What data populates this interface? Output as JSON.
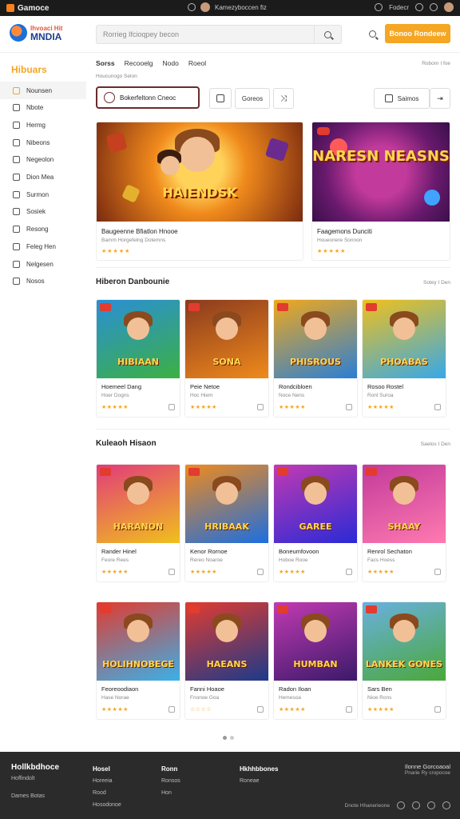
{
  "topbar": {
    "brand": "Gamoce",
    "center_text": "Kamezyboccen fiz",
    "right_text": "Fodecr"
  },
  "header": {
    "logo_line1": "Ihvoaci Hit",
    "logo_line2": "MNDIA",
    "search_placeholder": "Rorrieg Ifcioqpey becon",
    "cta_label": "Bonoo Rondeew"
  },
  "sidebar": {
    "title": "Hibuars",
    "items": [
      {
        "label": "Nounsen",
        "icon": "square-icon"
      },
      {
        "label": "Nbote",
        "icon": "grid-icon"
      },
      {
        "label": "Hermg",
        "icon": "pen-icon"
      },
      {
        "label": "Nibeons",
        "icon": "list-icon"
      },
      {
        "label": "Negeolon",
        "icon": "pen-icon"
      },
      {
        "label": "Dion Mea",
        "icon": "chat-icon"
      },
      {
        "label": "Surmon",
        "icon": "list-icon"
      },
      {
        "label": "Sosiek",
        "icon": "gear-icon"
      },
      {
        "label": "Resong",
        "icon": "square-icon"
      },
      {
        "label": "Feleg Hen",
        "icon": "grid-icon"
      },
      {
        "label": "Nelgesen",
        "icon": "list-icon"
      },
      {
        "label": "Nosos",
        "icon": "pen-icon"
      }
    ]
  },
  "main": {
    "tabs": [
      "Sorss",
      "Recooelg",
      "Nodo",
      "Roeol"
    ],
    "breadcrumb": "Houcunogo Selon",
    "top_right": "Robonr I foe",
    "filter_primary": "Bokerfeltonn Cneoc",
    "filter_buttons": [
      "",
      "Goreos",
      "",
      "Saimos",
      ""
    ],
    "heroes": [
      {
        "art_title": "HAIENDSK",
        "name": "Baugeenne Bfiatlon Hnooe",
        "sub": "Bamm Horgefelng Dotemns",
        "rating": "★★★★★"
      },
      {
        "art_title": "NARESN NEASNS",
        "name": "Faagemons Dunciti",
        "sub": "Houeonere Sonnon",
        "rating": "★★★★★"
      }
    ],
    "section1": {
      "title": "Hiberon Danbounie",
      "more": "Sotey I Den"
    },
    "section2": {
      "title": "Kuleaoh Hisaon",
      "more": "Saelos I Den"
    },
    "cards_row1": [
      {
        "art": "HIBIAAN",
        "name": "Hoemeel Dang",
        "sub": "Hoer Dogns",
        "rating": "★★★★★"
      },
      {
        "art": "SONA",
        "name": "Peie Netoe",
        "sub": "Hoc Hiem",
        "rating": "★★★★★"
      },
      {
        "art": "PHISROUS",
        "name": "Rondcibloen",
        "sub": "Noce Nens",
        "rating": "★★★★★"
      },
      {
        "art": "PHOABAS",
        "name": "Rosoo Rostel",
        "sub": "Ronl Suroa",
        "rating": "★★★★★"
      }
    ],
    "cards_row2": [
      {
        "art": "HARANON",
        "name": "Rander Hinel",
        "sub": "Feore Rees",
        "rating": "★★★★★"
      },
      {
        "art": "HRIBAAK",
        "name": "Kenor Rornoe",
        "sub": "Rereo Noaroe",
        "rating": "★★★★★"
      },
      {
        "art": "GAREE",
        "name": "Boneumfovoon",
        "sub": "Hoboe Rooe",
        "rating": "★★★★★"
      },
      {
        "art": "SHAAY",
        "name": "Renrol Sechaton",
        "sub": "Facs Hoess",
        "rating": "★★★★★"
      }
    ],
    "cards_row3": [
      {
        "art": "HOLIHNOBEGE",
        "name": "Feoreoodiaon",
        "sub": "Hase Norae",
        "rating": "★★★★★"
      },
      {
        "art": "HAEANS",
        "name": "Fanni Hoaoe",
        "sub": "Fnonoe Goa",
        "rating": "☆☆☆☆"
      },
      {
        "art": "HUMBAN",
        "name": "Radon Iloan",
        "sub": "Hemesoa",
        "rating": "★★★★★"
      },
      {
        "art": "LANKEK GONES",
        "name": "Sars Ben",
        "sub": "Nioe Rons",
        "rating": "★★★★★"
      }
    ]
  },
  "footer": {
    "brand": "Hollkbdhoce",
    "brand_sub": "Hoffindolt",
    "brand_sub2": "Dames Botas",
    "col1": {
      "head": "Hosel",
      "items": [
        "Horeeia",
        "Rood",
        "Hosodonoe"
      ]
    },
    "col2": {
      "head": "Ronn",
      "items": [
        "Ronsos",
        "Hon"
      ]
    },
    "col3": {
      "head": "Hkhhbbones",
      "items": [
        "Roneae"
      ]
    },
    "right_head": "Ilonne Gorcoaoal",
    "right_sub": "Pnarie Ry cropocoe",
    "social_label": "Dnote Hhanerieone"
  },
  "colors": {
    "accent": "#f5a623",
    "dark": "#2b2b2b"
  }
}
